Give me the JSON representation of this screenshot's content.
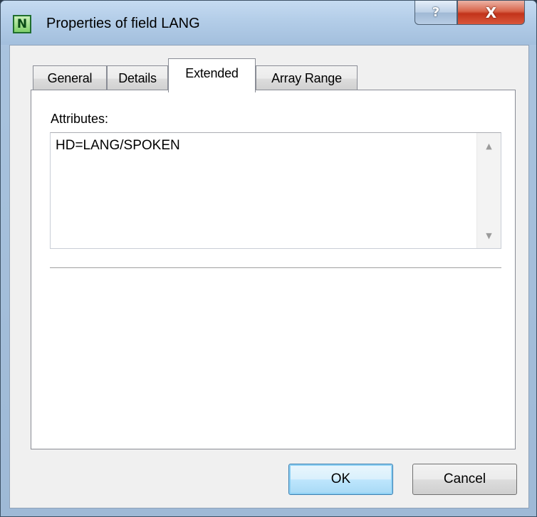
{
  "window": {
    "title": "Properties of field LANG",
    "app_icon_letter": "N",
    "help_glyph": "?",
    "close_glyph": "X"
  },
  "tabs": [
    {
      "label": "General",
      "active": false
    },
    {
      "label": "Details",
      "active": false
    },
    {
      "label": "Extended",
      "active": true
    },
    {
      "label": "Array Range",
      "active": false
    }
  ],
  "extended": {
    "attributes_label": "Attributes:",
    "attributes_value": "HD=LANG/SPOKEN"
  },
  "buttons": {
    "ok_label": "OK",
    "cancel_label": "Cancel"
  },
  "colors": {
    "close_button": "#c7391e",
    "default_button_border": "#3c7fb1"
  }
}
